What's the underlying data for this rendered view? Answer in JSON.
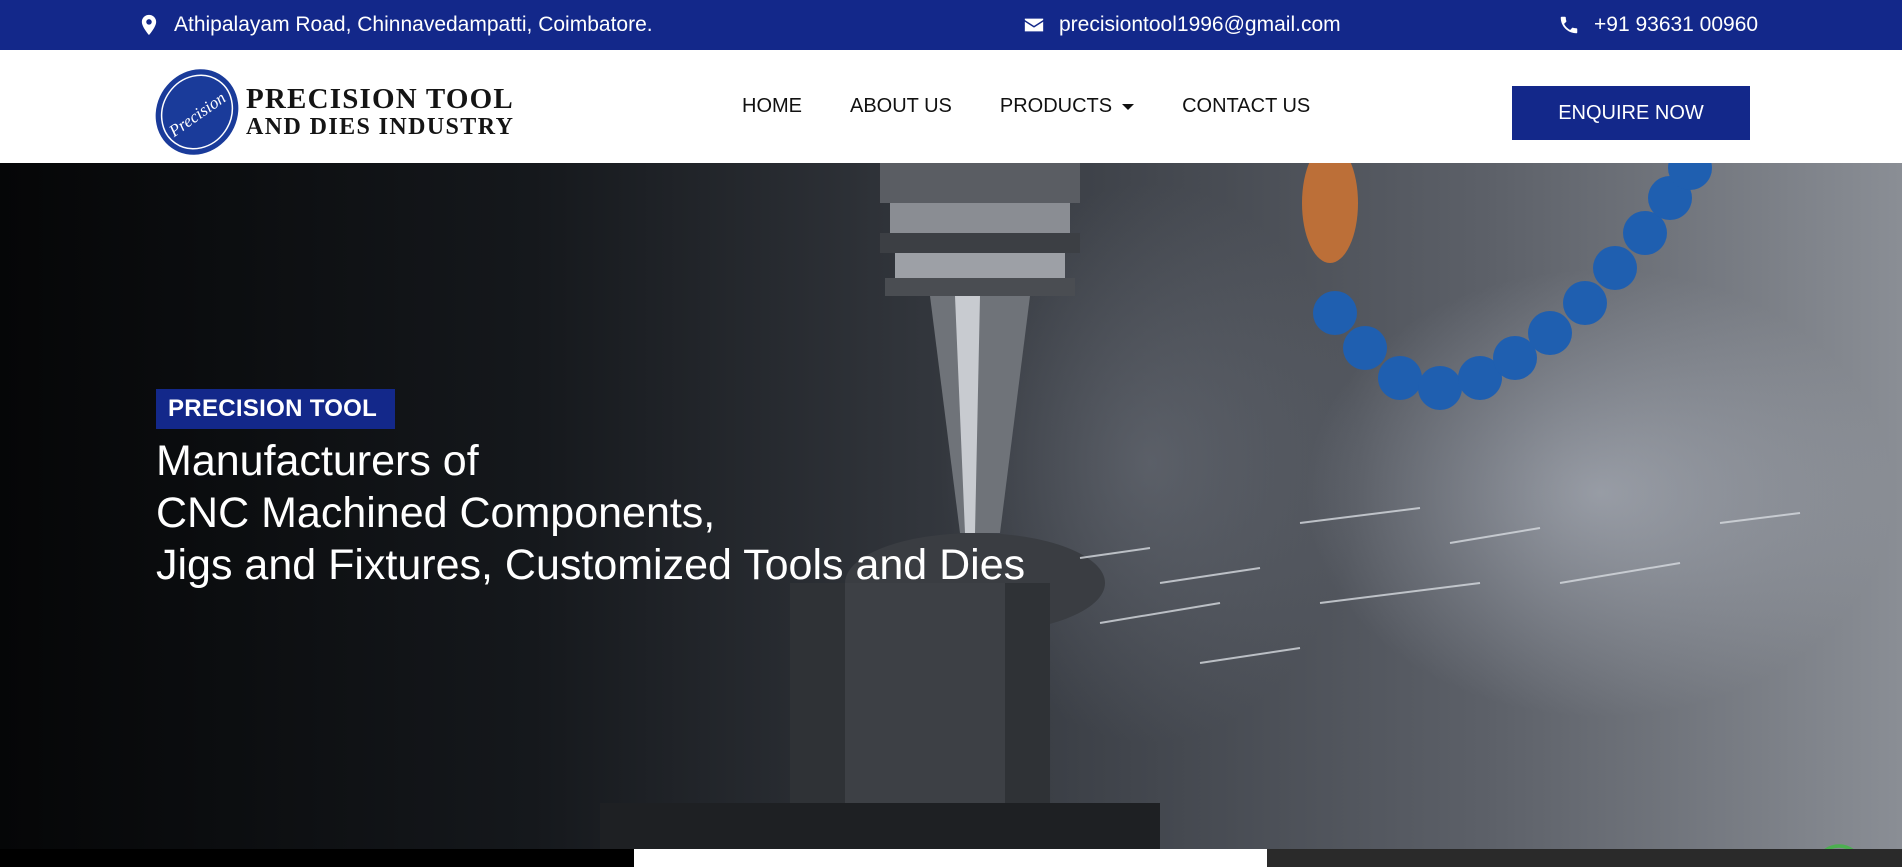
{
  "topbar": {
    "address": "Athipalayam Road, Chinnavedampatti, Coimbatore.",
    "email": "precisiontool1996@gmail.com",
    "phone": "+91 93631 00960"
  },
  "header": {
    "logo": {
      "mark_text": "Precision",
      "line1": "PRECISION TOOL",
      "line2": "AND DIES INDUSTRY"
    },
    "nav": [
      {
        "label": "HOME"
      },
      {
        "label": "ABOUT US"
      },
      {
        "label": "PRODUCTS"
      },
      {
        "label": "CONTACT US"
      }
    ],
    "cta_label": "ENQUIRE NOW"
  },
  "hero": {
    "badge": "PRECISION TOOL",
    "heading_lines": [
      "Manufacturers of",
      "CNC Machined Components,",
      "Jigs and Fixtures, Customized Tools and Dies"
    ]
  },
  "icons": {
    "address": "map-pin-icon",
    "email": "envelope-icon",
    "phone": "phone-icon",
    "whatsapp": "whatsapp-icon",
    "nav_dropdown": "caret-down-icon"
  },
  "colors": {
    "brand_blue": "#13288a",
    "whatsapp_green": "#4caf50",
    "white": "#ffffff"
  }
}
